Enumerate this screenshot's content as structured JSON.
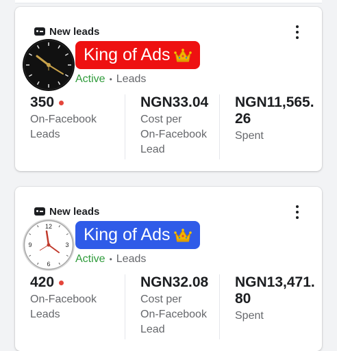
{
  "cards": [
    {
      "tag": "New leads",
      "title": "King of Ads",
      "title_color": "#ee1111",
      "status": "Active",
      "status_sep": "•",
      "objective": "Leads",
      "avatar": "clock-black-face",
      "metrics": [
        {
          "value": "350",
          "label_lines": [
            "On-Facebook",
            "Leads"
          ]
        },
        {
          "value": "NGN33.04",
          "label_lines": [
            "Cost per",
            "On-Facebook",
            "Lead"
          ]
        },
        {
          "value_lines": [
            "NGN11,565.",
            "26"
          ],
          "label_lines": [
            "Spent"
          ]
        }
      ]
    },
    {
      "tag": "New leads",
      "title": "King of Ads",
      "title_color": "#2f5be8",
      "status": "Active",
      "status_sep": "•",
      "objective": "Leads",
      "avatar": "clock-white-face",
      "clock_numerals": [
        "12",
        "3",
        "6",
        "9"
      ],
      "metrics": [
        {
          "value": "420",
          "label_lines": [
            "On-Facebook",
            "Leads"
          ]
        },
        {
          "value": "NGN32.08",
          "label_lines": [
            "Cost per",
            "On-Facebook",
            "Lead"
          ]
        },
        {
          "value_lines": [
            "NGN13,471.",
            "80"
          ],
          "label_lines": [
            "Spent"
          ]
        }
      ]
    }
  ],
  "icons": {
    "tag": "lead-form-icon",
    "menu": "more-vertical-icon",
    "title_emoji": "crown-icon",
    "metric_indicator": "red-dot"
  },
  "colors": {
    "active": "#2e9b3a",
    "dot": "#e4463b",
    "secondary_text": "#65676b"
  }
}
